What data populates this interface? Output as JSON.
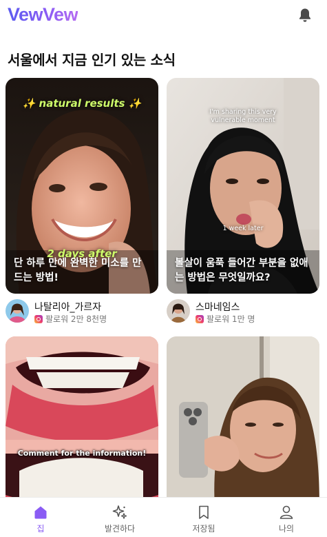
{
  "app": {
    "logo": "VewVew"
  },
  "section": {
    "title": "서울에서 지금 인기 있는 소식"
  },
  "cards": [
    {
      "caption": "단 하루 만에 완벽한 미소를 만드는 방법!",
      "overlay_top": "✨ natural results ✨",
      "overlay_bottom": "2 days after",
      "author_name": "나탈리아_가르자",
      "author_followers": "팔로워 2만 8천명"
    },
    {
      "caption": "볼살이 움푹 들어간 부분을 없애는 방법은 무엇일까요?",
      "overlay_top": "I'm sharing this very vulnerable moment",
      "overlay_bottom": "1 week later",
      "author_name": "스마네임스",
      "author_followers": "팔로워 1만 명"
    },
    {
      "overlay_bottom": "Comment for the information!"
    },
    {}
  ],
  "nav": [
    {
      "label": "집",
      "icon": "home-icon",
      "active": true
    },
    {
      "label": "발견하다",
      "icon": "sparkle-icon",
      "active": false
    },
    {
      "label": "저장됨",
      "icon": "bookmark-icon",
      "active": false
    },
    {
      "label": "나의",
      "icon": "user-icon",
      "active": false
    }
  ],
  "colors": {
    "accent": "#8a5cf4",
    "logo_start": "#5b5cf0",
    "logo_end": "#b46cf2"
  }
}
